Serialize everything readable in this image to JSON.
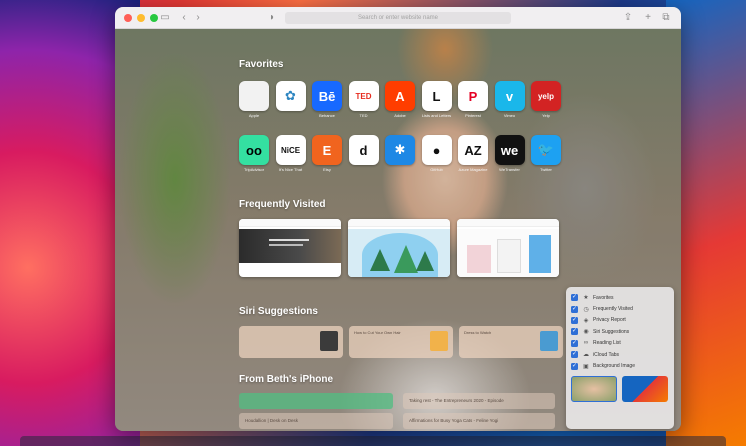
{
  "toolbar": {
    "address_placeholder": "Search or enter website name",
    "sidebar_icon": "sidebar-icon",
    "back_icon": "chevron-left-icon",
    "forward_icon": "chevron-right-icon",
    "privacy_icon": "shield-icon",
    "share_icon": "share-icon",
    "new_tab_icon": "plus-icon",
    "tab_overview_icon": "tabs-icon"
  },
  "favorites": {
    "title": "Favorites",
    "items": [
      {
        "label": "Apple",
        "glyph": "",
        "bg": "#f2f2f2",
        "fg": "#555555"
      },
      {
        "label": "",
        "glyph": "✿",
        "bg": "#ffffff",
        "fg": "#2e86c1"
      },
      {
        "label": "Behance",
        "glyph": "Bē",
        "bg": "#1769ff",
        "fg": "#ffffff"
      },
      {
        "label": "TED",
        "glyph": "TED",
        "bg": "#ffffff",
        "fg": "#e62b1e"
      },
      {
        "label": "Adobe",
        "glyph": "A",
        "bg": "#ff3d00",
        "fg": "#ffffff"
      },
      {
        "label": "Lists and Letters",
        "glyph": "L",
        "bg": "#ffffff",
        "fg": "#111111"
      },
      {
        "label": "Pinterest",
        "glyph": "P",
        "bg": "#ffffff",
        "fg": "#e60023"
      },
      {
        "label": "Vimeo",
        "glyph": "v",
        "bg": "#1ab7ea",
        "fg": "#ffffff"
      },
      {
        "label": "Yelp",
        "glyph": "yelp",
        "bg": "#d32323",
        "fg": "#ffffff"
      },
      {
        "label": "TripAdvisor",
        "glyph": "oo",
        "bg": "#34e0a1",
        "fg": "#000000"
      },
      {
        "label": "It's Nice That",
        "glyph": "NiCE",
        "bg": "#ffffff",
        "fg": "#111111"
      },
      {
        "label": "Etsy",
        "glyph": "E",
        "bg": "#f1641e",
        "fg": "#ffffff"
      },
      {
        "label": "",
        "glyph": "d",
        "bg": "#ffffff",
        "fg": "#111111"
      },
      {
        "label": "",
        "glyph": "✱",
        "bg": "#1e88e5",
        "fg": "#ffffff"
      },
      {
        "label": "GitHub",
        "glyph": "●",
        "bg": "#ffffff",
        "fg": "#111111"
      },
      {
        "label": "Azure Magazine",
        "glyph": "AZ",
        "bg": "#ffffff",
        "fg": "#111111"
      },
      {
        "label": "WeTransfer",
        "glyph": "we",
        "bg": "#111111",
        "fg": "#ffffff"
      },
      {
        "label": "Twitter",
        "glyph": "🐦",
        "bg": "#1da1f2",
        "fg": "#ffffff"
      }
    ]
  },
  "frequently_visited": {
    "title": "Frequently Visited",
    "cards": [
      {
        "caption": ""
      },
      {
        "caption": ""
      },
      {
        "caption": ""
      }
    ]
  },
  "siri_suggestions": {
    "title": "Siri Suggestions",
    "cards": [
      {
        "title": "",
        "subtitle": "",
        "thumb": "#3b3b3b"
      },
      {
        "title": "How to Cut Your Own Hair",
        "subtitle": "",
        "thumb": "#f1b24a"
      },
      {
        "title": "Dress to Watch",
        "subtitle": "",
        "thumb": "#4a9bd1"
      }
    ]
  },
  "from_iphone": {
    "title": "From Beth's iPhone",
    "items": [
      {
        "label": "",
        "green": true
      },
      {
        "label": "Taking rest - The Entrepreneurs 2020 - Episode",
        "green": false
      },
      {
        "label": "Houdallion | Desk on Desk",
        "green": false
      },
      {
        "label": "Affirmations for Busy Yoga Cats - Feline Yogi",
        "green": false
      }
    ]
  },
  "customize": {
    "options": [
      {
        "label": "Favorites",
        "checked": true,
        "icon": "star-icon",
        "glyph": "★"
      },
      {
        "label": "Frequently Visited",
        "checked": true,
        "icon": "clock-icon",
        "glyph": "◷"
      },
      {
        "label": "Privacy Report",
        "checked": true,
        "icon": "shield-icon",
        "glyph": "◈"
      },
      {
        "label": "Siri Suggestions",
        "checked": true,
        "icon": "siri-icon",
        "glyph": "◉"
      },
      {
        "label": "Reading List",
        "checked": true,
        "icon": "glasses-icon",
        "glyph": "∞"
      },
      {
        "label": "iCloud Tabs",
        "checked": true,
        "icon": "cloud-icon",
        "glyph": "☁"
      },
      {
        "label": "Background Image",
        "checked": true,
        "icon": "image-icon",
        "glyph": "▣"
      }
    ],
    "settings_icon": "sliders-icon"
  }
}
